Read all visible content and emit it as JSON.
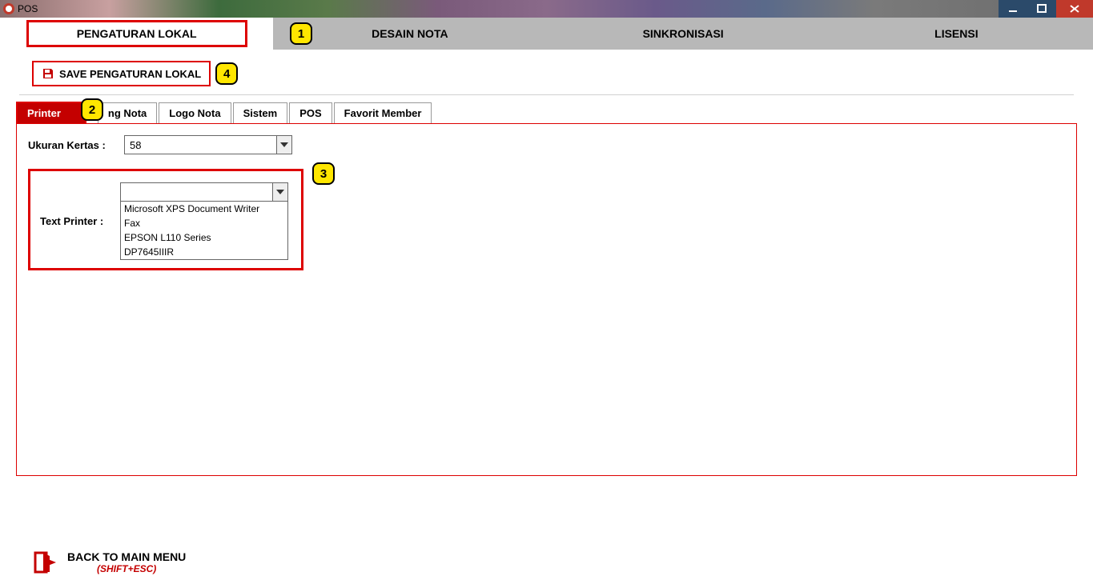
{
  "window": {
    "title": "POS"
  },
  "topnav": {
    "tabs": [
      {
        "label": "PENGATURAN LOKAL",
        "active": true
      },
      {
        "label": "DESAIN NOTA",
        "active": false
      },
      {
        "label": "SINKRONISASI",
        "active": false
      },
      {
        "label": "LISENSI",
        "active": false
      }
    ]
  },
  "save_button": {
    "label": "SAVE PENGATURAN LOKAL"
  },
  "inner_tabs": [
    {
      "label": "Printer",
      "active": true
    },
    {
      "label": "ng Nota",
      "active": false
    },
    {
      "label": "Logo Nota",
      "active": false
    },
    {
      "label": "Sistem",
      "active": false
    },
    {
      "label": "POS",
      "active": false
    },
    {
      "label": "Favorit Member",
      "active": false
    }
  ],
  "printer_panel": {
    "paper_size": {
      "label": "Ukuran Kertas :",
      "value": "58"
    },
    "text_printer": {
      "label": "Text Printer :",
      "value": "",
      "options": [
        "Microsoft XPS Document Writer",
        "Fax",
        "EPSON L110 Series",
        "DP7645IIIR"
      ]
    }
  },
  "back": {
    "label": "BACK TO MAIN MENU",
    "shortcut": "(SHIFT+ESC)"
  },
  "annotations": {
    "b1": "1",
    "b2": "2",
    "b3": "3",
    "b4": "4"
  }
}
